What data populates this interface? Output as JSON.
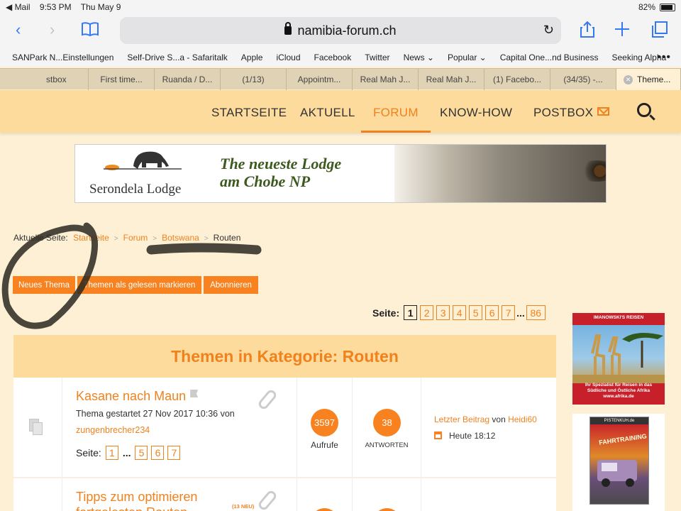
{
  "status": {
    "back_app": "◀ Mail",
    "time": "9:53 PM",
    "date": "Thu May 9",
    "battery": "82%"
  },
  "browser": {
    "url": "namibia-forum.ch"
  },
  "bookmarks": [
    "SANPark N...Einstellungen",
    "Self-Drive S...a - Safaritalk",
    "Apple",
    "iCloud",
    "Facebook",
    "Twitter",
    "News ⌄",
    "Popular ⌄",
    "Capital One...nd Business",
    "Seeking Alpha"
  ],
  "bookmarks_more": "•••",
  "tabs": [
    "stbox",
    "First time...",
    "Ruanda / D...",
    "(1/13)",
    "Appointm...",
    "Real Mah J...",
    "Real Mah J...",
    "(1) Facebo...",
    "(34/35) -...",
    "Theme..."
  ],
  "nav": {
    "items": [
      "STARTSEITE",
      "AKTUELL",
      "FORUM",
      "KNOW-HOW",
      "POSTBOX"
    ],
    "active": "FORUM"
  },
  "banner": {
    "lodge": "Serondela Lodge",
    "tagline1": "The neueste Lodge",
    "tagline2": "am Chobe NP"
  },
  "breadcrumb": {
    "label": "Aktuelle Seite:",
    "items": [
      "Startseite",
      "Forum",
      "Botswana"
    ],
    "current": "Routen"
  },
  "actions": [
    "Neues Thema",
    "Themen als gelesen markieren",
    "Abonnieren"
  ],
  "pagination": {
    "label": "Seite:",
    "pages": [
      "1",
      "2",
      "3",
      "4",
      "5",
      "6",
      "7"
    ],
    "ellipsis": "...",
    "last": "86",
    "current": "1"
  },
  "category": {
    "title": "Themen in Kategorie: Routen"
  },
  "topics": [
    {
      "title": "Kasane nach Maun",
      "meta": "Thema gestartet 27 Nov 2017 10:36 von",
      "author": "zungenbrecher234",
      "pages_label": "Seite:",
      "pages": [
        "1",
        "5",
        "6",
        "7"
      ],
      "ellipsis": "...",
      "views": "3597",
      "views_label": "Aufrufe",
      "replies": "38",
      "replies_label": "ANTWORTEN",
      "last_label": "Letzter Beitrag",
      "last_by": "von",
      "last_user": "Heidi60",
      "last_time": "Heute 18:12"
    },
    {
      "title": "Tipps zum optimieren",
      "title2": "fortgelesten Routen",
      "new_badge": "(13 NEU)"
    }
  ],
  "ads": {
    "ad1_header": "IMANOWSKI'S REISEN",
    "ad1_text": "Ihr Spezialist für Reisen in das Südliche und Östliche Afrika www.afrika.de",
    "ad2_header": "PISTENKUH.de",
    "ad2_title": "FAHRTRAINING"
  }
}
